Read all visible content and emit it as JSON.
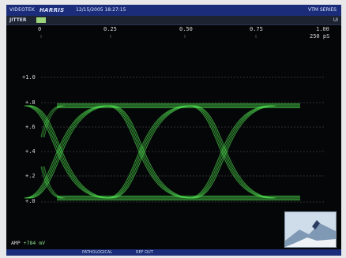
{
  "header": {
    "brand": "VIDEOTEK",
    "brand2": "HARRIS",
    "datetime": "12/15/2005 18:27:15",
    "series": "VTM SERIES"
  },
  "tab": {
    "label": "JITTER",
    "unit": "UI"
  },
  "axes": {
    "x_ticks": [
      "0",
      "0.25",
      "0.50",
      "0.75",
      "1.00"
    ],
    "x_extra": "250 pS",
    "y_ticks": [
      "+1.0",
      "+.8",
      "+.6",
      "+.4",
      "+.2",
      "+.0"
    ]
  },
  "status": {
    "amp_label": "AMP",
    "amp_value": "+784 mV"
  },
  "footer": {
    "left": "PATHOLOGICAL",
    "right": "REF OUT"
  },
  "colors": {
    "trace": "#4fe04f",
    "header_bg": "#1b2d7a",
    "grid": "#5a5a5a"
  }
}
